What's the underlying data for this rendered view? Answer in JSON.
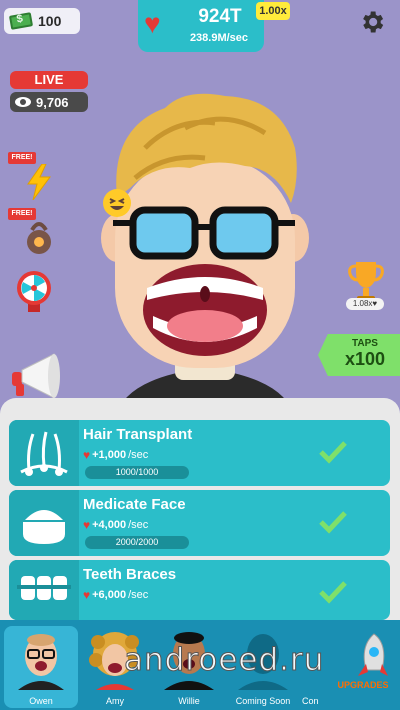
{
  "hud": {
    "cash": "100",
    "total_hearts": "924T",
    "per_sec": "238.9M/sec",
    "multiplier": "1.00x"
  },
  "stream": {
    "live_label": "LIVE",
    "viewers": "9,706"
  },
  "side": {
    "free_label_1": "FREE!",
    "free_label_2": "FREE!",
    "trophy_badge": "1.08x♥"
  },
  "taps": {
    "label": "TAPS",
    "value": "x100"
  },
  "upgrades": [
    {
      "name": "Hair Transplant",
      "rate": "+1,000",
      "unit": "/sec",
      "progress": "1000/1000",
      "complete": true
    },
    {
      "name": "Medicate Face",
      "rate": "+4,000",
      "unit": "/sec",
      "progress": "2000/2000",
      "complete": true
    },
    {
      "name": "Teeth Braces",
      "rate": "+6,000",
      "unit": "/sec",
      "progress": "",
      "complete": true
    }
  ],
  "characters": [
    {
      "name": "Owen",
      "selected": true
    },
    {
      "name": "Amy",
      "selected": false
    },
    {
      "name": "Willie",
      "selected": false
    },
    {
      "name": "Coming Soon",
      "selected": false
    },
    {
      "name": "Con",
      "selected": false
    }
  ],
  "upgrades_button": "UPGRADES",
  "watermark": "androeed.ru",
  "colors": {
    "background": "#9b94c9",
    "accent_teal": "#2bbec9",
    "heart_red": "#e53935",
    "taps_green": "#7fe06a",
    "bottom_bar": "#1a8fb3"
  }
}
